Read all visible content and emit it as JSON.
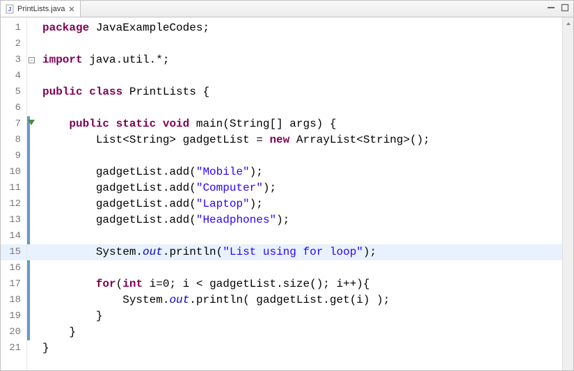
{
  "tab": {
    "filename": "PrintLists.java"
  },
  "lines": [
    {
      "n": "1",
      "marker": "",
      "html": "<span class='kw'>package</span><span class='txt'> JavaExampleCodes;</span>"
    },
    {
      "n": "2",
      "marker": "",
      "html": ""
    },
    {
      "n": "3",
      "marker": "fold",
      "html": "<span class='kw'>import</span><span class='txt'> java.util.*;</span>"
    },
    {
      "n": "4",
      "marker": "",
      "html": ""
    },
    {
      "n": "5",
      "marker": "",
      "html": "<span class='kw'>public</span><span class='txt'> </span><span class='kw'>class</span><span class='txt'> PrintLists {</span>"
    },
    {
      "n": "6",
      "marker": "",
      "html": ""
    },
    {
      "n": "7",
      "marker": "override-fold",
      "html": "<span class='txt'>    </span><span class='kw'>public</span><span class='txt'> </span><span class='kw'>static</span><span class='txt'> </span><span class='kw'>void</span><span class='txt'> main(String[] args) {</span>"
    },
    {
      "n": "8",
      "marker": "",
      "html": "<span class='txt'>        List&lt;String&gt; gadgetList = </span><span class='kw'>new</span><span class='txt'> ArrayList&lt;String&gt;();</span>"
    },
    {
      "n": "9",
      "marker": "",
      "html": ""
    },
    {
      "n": "10",
      "marker": "",
      "html": "<span class='txt'>        gadgetList.add(</span><span class='str'>\"Mobile\"</span><span class='txt'>);</span>"
    },
    {
      "n": "11",
      "marker": "",
      "html": "<span class='txt'>        gadgetList.add(</span><span class='str'>\"Computer\"</span><span class='txt'>);</span>"
    },
    {
      "n": "12",
      "marker": "",
      "html": "<span class='txt'>        gadgetList.add(</span><span class='str'>\"Laptop\"</span><span class='txt'>);</span>"
    },
    {
      "n": "13",
      "marker": "",
      "html": "<span class='txt'>        gadgetList.add(</span><span class='str'>\"Headphones\"</span><span class='txt'>);</span>"
    },
    {
      "n": "14",
      "marker": "",
      "html": ""
    },
    {
      "n": "15",
      "marker": "",
      "highlight": true,
      "html": "<span class='txt'>        System.</span><span class='fld'>out</span><span class='txt'>.println(</span><span class='str'>\"List using for loop\"</span><span class='txt'>);</span>"
    },
    {
      "n": "16",
      "marker": "",
      "html": ""
    },
    {
      "n": "17",
      "marker": "",
      "html": "<span class='txt'>        </span><span class='kw'>for</span><span class='txt'>(</span><span class='kw'>int</span><span class='txt'> i=0; i &lt; gadgetList.size(); i++){</span>"
    },
    {
      "n": "18",
      "marker": "",
      "html": "<span class='txt'>            System.</span><span class='fld'>out</span><span class='txt'>.println( gadgetList.get(i) );</span>"
    },
    {
      "n": "19",
      "marker": "",
      "html": "<span class='txt'>        }</span>"
    },
    {
      "n": "20",
      "marker": "",
      "html": "<span class='txt'>    }</span>"
    },
    {
      "n": "21",
      "marker": "",
      "html": "<span class='txt'>}</span>"
    }
  ],
  "range": {
    "start": 7,
    "end": 20
  }
}
